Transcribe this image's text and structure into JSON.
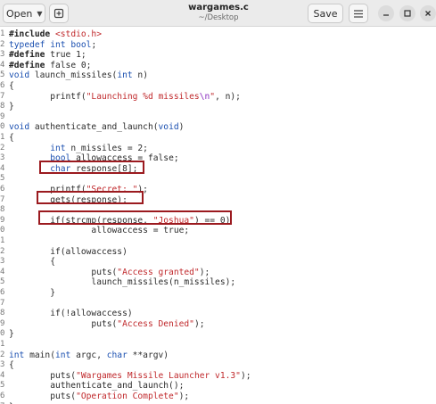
{
  "window": {
    "title": "wargames.c",
    "subtitle": "~/Desktop",
    "open_label": "Open",
    "save_label": "Save"
  },
  "icons": {
    "open_chevron": "chevron-down-icon",
    "new_tab": "new-tab-icon",
    "menu": "hamburger-menu-icon",
    "minimize": "minimize-icon",
    "maximize": "maximize-icon",
    "close": "close-icon"
  },
  "colors": {
    "keyword": "#1a4fb0",
    "string": "#c0292c",
    "highlight_box": "#9b1a1f"
  },
  "code_lines": [
    {
      "n": "1",
      "text": "#include <stdio.h>"
    },
    {
      "n": "2",
      "text": "typedef int bool;"
    },
    {
      "n": "3",
      "text": "#define true 1;"
    },
    {
      "n": "4",
      "text": "#define false 0;"
    },
    {
      "n": "5",
      "text": "void launch_missiles(int n)"
    },
    {
      "n": "6",
      "text": "{"
    },
    {
      "n": "7",
      "text": "        printf(\"Launching %d missiles\\n\", n);"
    },
    {
      "n": "8",
      "text": "}"
    },
    {
      "n": "9",
      "text": ""
    },
    {
      "n": "0",
      "text": "void authenticate_and_launch(void)"
    },
    {
      "n": "1",
      "text": "{"
    },
    {
      "n": "2",
      "text": "        int n_missiles = 2;"
    },
    {
      "n": "3",
      "text": "        bool allowaccess = false;"
    },
    {
      "n": "4",
      "text": "        char response[8];"
    },
    {
      "n": "5",
      "text": ""
    },
    {
      "n": "6",
      "text": "        printf(\"Secret: \");"
    },
    {
      "n": "7",
      "text": "        gets(response);"
    },
    {
      "n": "8",
      "text": ""
    },
    {
      "n": "9",
      "text": "        if(strcmp(response, \"Joshua\") == 0)"
    },
    {
      "n": "0",
      "text": "                allowaccess = true;"
    },
    {
      "n": "1",
      "text": ""
    },
    {
      "n": "2",
      "text": "        if(allowaccess)"
    },
    {
      "n": "3",
      "text": "        {"
    },
    {
      "n": "4",
      "text": "                puts(\"Access granted\");"
    },
    {
      "n": "5",
      "text": "                launch_missiles(n_missiles);"
    },
    {
      "n": "6",
      "text": "        }"
    },
    {
      "n": "7",
      "text": ""
    },
    {
      "n": "8",
      "text": "        if(!allowaccess)"
    },
    {
      "n": "9",
      "text": "                puts(\"Access Denied\");"
    },
    {
      "n": "0",
      "text": "}"
    },
    {
      "n": "1",
      "text": ""
    },
    {
      "n": "2",
      "text": "int main(int argc, char **argv)"
    },
    {
      "n": "3",
      "text": "{"
    },
    {
      "n": "4",
      "text": "        puts(\"Wargames Missile Launcher v1.3\");"
    },
    {
      "n": "5",
      "text": "        authenticate_and_launch();"
    },
    {
      "n": "6",
      "text": "        puts(\"Operation Complete\");"
    },
    {
      "n": "7",
      "text": "}"
    }
  ]
}
